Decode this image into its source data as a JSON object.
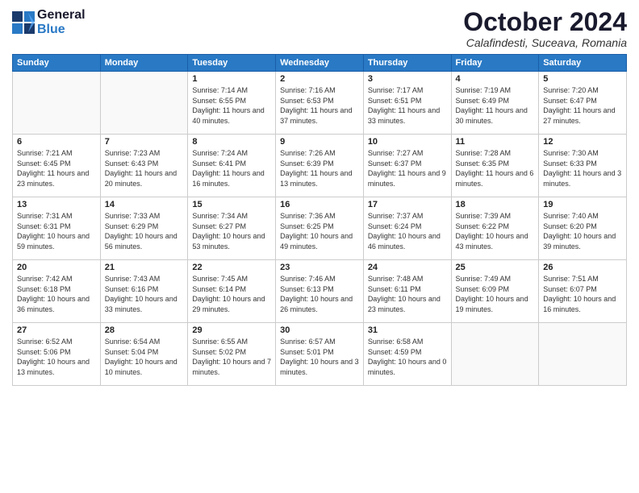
{
  "logo": {
    "line1": "General",
    "line2": "Blue"
  },
  "title": "October 2024",
  "location": "Calafindesti, Suceava, Romania",
  "weekdays": [
    "Sunday",
    "Monday",
    "Tuesday",
    "Wednesday",
    "Thursday",
    "Friday",
    "Saturday"
  ],
  "weeks": [
    [
      {
        "day": "",
        "sunrise": "",
        "sunset": "",
        "daylight": ""
      },
      {
        "day": "",
        "sunrise": "",
        "sunset": "",
        "daylight": ""
      },
      {
        "day": "1",
        "sunrise": "Sunrise: 7:14 AM",
        "sunset": "Sunset: 6:55 PM",
        "daylight": "Daylight: 11 hours and 40 minutes."
      },
      {
        "day": "2",
        "sunrise": "Sunrise: 7:16 AM",
        "sunset": "Sunset: 6:53 PM",
        "daylight": "Daylight: 11 hours and 37 minutes."
      },
      {
        "day": "3",
        "sunrise": "Sunrise: 7:17 AM",
        "sunset": "Sunset: 6:51 PM",
        "daylight": "Daylight: 11 hours and 33 minutes."
      },
      {
        "day": "4",
        "sunrise": "Sunrise: 7:19 AM",
        "sunset": "Sunset: 6:49 PM",
        "daylight": "Daylight: 11 hours and 30 minutes."
      },
      {
        "day": "5",
        "sunrise": "Sunrise: 7:20 AM",
        "sunset": "Sunset: 6:47 PM",
        "daylight": "Daylight: 11 hours and 27 minutes."
      }
    ],
    [
      {
        "day": "6",
        "sunrise": "Sunrise: 7:21 AM",
        "sunset": "Sunset: 6:45 PM",
        "daylight": "Daylight: 11 hours and 23 minutes."
      },
      {
        "day": "7",
        "sunrise": "Sunrise: 7:23 AM",
        "sunset": "Sunset: 6:43 PM",
        "daylight": "Daylight: 11 hours and 20 minutes."
      },
      {
        "day": "8",
        "sunrise": "Sunrise: 7:24 AM",
        "sunset": "Sunset: 6:41 PM",
        "daylight": "Daylight: 11 hours and 16 minutes."
      },
      {
        "day": "9",
        "sunrise": "Sunrise: 7:26 AM",
        "sunset": "Sunset: 6:39 PM",
        "daylight": "Daylight: 11 hours and 13 minutes."
      },
      {
        "day": "10",
        "sunrise": "Sunrise: 7:27 AM",
        "sunset": "Sunset: 6:37 PM",
        "daylight": "Daylight: 11 hours and 9 minutes."
      },
      {
        "day": "11",
        "sunrise": "Sunrise: 7:28 AM",
        "sunset": "Sunset: 6:35 PM",
        "daylight": "Daylight: 11 hours and 6 minutes."
      },
      {
        "day": "12",
        "sunrise": "Sunrise: 7:30 AM",
        "sunset": "Sunset: 6:33 PM",
        "daylight": "Daylight: 11 hours and 3 minutes."
      }
    ],
    [
      {
        "day": "13",
        "sunrise": "Sunrise: 7:31 AM",
        "sunset": "Sunset: 6:31 PM",
        "daylight": "Daylight: 10 hours and 59 minutes."
      },
      {
        "day": "14",
        "sunrise": "Sunrise: 7:33 AM",
        "sunset": "Sunset: 6:29 PM",
        "daylight": "Daylight: 10 hours and 56 minutes."
      },
      {
        "day": "15",
        "sunrise": "Sunrise: 7:34 AM",
        "sunset": "Sunset: 6:27 PM",
        "daylight": "Daylight: 10 hours and 53 minutes."
      },
      {
        "day": "16",
        "sunrise": "Sunrise: 7:36 AM",
        "sunset": "Sunset: 6:25 PM",
        "daylight": "Daylight: 10 hours and 49 minutes."
      },
      {
        "day": "17",
        "sunrise": "Sunrise: 7:37 AM",
        "sunset": "Sunset: 6:24 PM",
        "daylight": "Daylight: 10 hours and 46 minutes."
      },
      {
        "day": "18",
        "sunrise": "Sunrise: 7:39 AM",
        "sunset": "Sunset: 6:22 PM",
        "daylight": "Daylight: 10 hours and 43 minutes."
      },
      {
        "day": "19",
        "sunrise": "Sunrise: 7:40 AM",
        "sunset": "Sunset: 6:20 PM",
        "daylight": "Daylight: 10 hours and 39 minutes."
      }
    ],
    [
      {
        "day": "20",
        "sunrise": "Sunrise: 7:42 AM",
        "sunset": "Sunset: 6:18 PM",
        "daylight": "Daylight: 10 hours and 36 minutes."
      },
      {
        "day": "21",
        "sunrise": "Sunrise: 7:43 AM",
        "sunset": "Sunset: 6:16 PM",
        "daylight": "Daylight: 10 hours and 33 minutes."
      },
      {
        "day": "22",
        "sunrise": "Sunrise: 7:45 AM",
        "sunset": "Sunset: 6:14 PM",
        "daylight": "Daylight: 10 hours and 29 minutes."
      },
      {
        "day": "23",
        "sunrise": "Sunrise: 7:46 AM",
        "sunset": "Sunset: 6:13 PM",
        "daylight": "Daylight: 10 hours and 26 minutes."
      },
      {
        "day": "24",
        "sunrise": "Sunrise: 7:48 AM",
        "sunset": "Sunset: 6:11 PM",
        "daylight": "Daylight: 10 hours and 23 minutes."
      },
      {
        "day": "25",
        "sunrise": "Sunrise: 7:49 AM",
        "sunset": "Sunset: 6:09 PM",
        "daylight": "Daylight: 10 hours and 19 minutes."
      },
      {
        "day": "26",
        "sunrise": "Sunrise: 7:51 AM",
        "sunset": "Sunset: 6:07 PM",
        "daylight": "Daylight: 10 hours and 16 minutes."
      }
    ],
    [
      {
        "day": "27",
        "sunrise": "Sunrise: 6:52 AM",
        "sunset": "Sunset: 5:06 PM",
        "daylight": "Daylight: 10 hours and 13 minutes."
      },
      {
        "day": "28",
        "sunrise": "Sunrise: 6:54 AM",
        "sunset": "Sunset: 5:04 PM",
        "daylight": "Daylight: 10 hours and 10 minutes."
      },
      {
        "day": "29",
        "sunrise": "Sunrise: 6:55 AM",
        "sunset": "Sunset: 5:02 PM",
        "daylight": "Daylight: 10 hours and 7 minutes."
      },
      {
        "day": "30",
        "sunrise": "Sunrise: 6:57 AM",
        "sunset": "Sunset: 5:01 PM",
        "daylight": "Daylight: 10 hours and 3 minutes."
      },
      {
        "day": "31",
        "sunrise": "Sunrise: 6:58 AM",
        "sunset": "Sunset: 4:59 PM",
        "daylight": "Daylight: 10 hours and 0 minutes."
      },
      {
        "day": "",
        "sunrise": "",
        "sunset": "",
        "daylight": ""
      },
      {
        "day": "",
        "sunrise": "",
        "sunset": "",
        "daylight": ""
      }
    ]
  ]
}
